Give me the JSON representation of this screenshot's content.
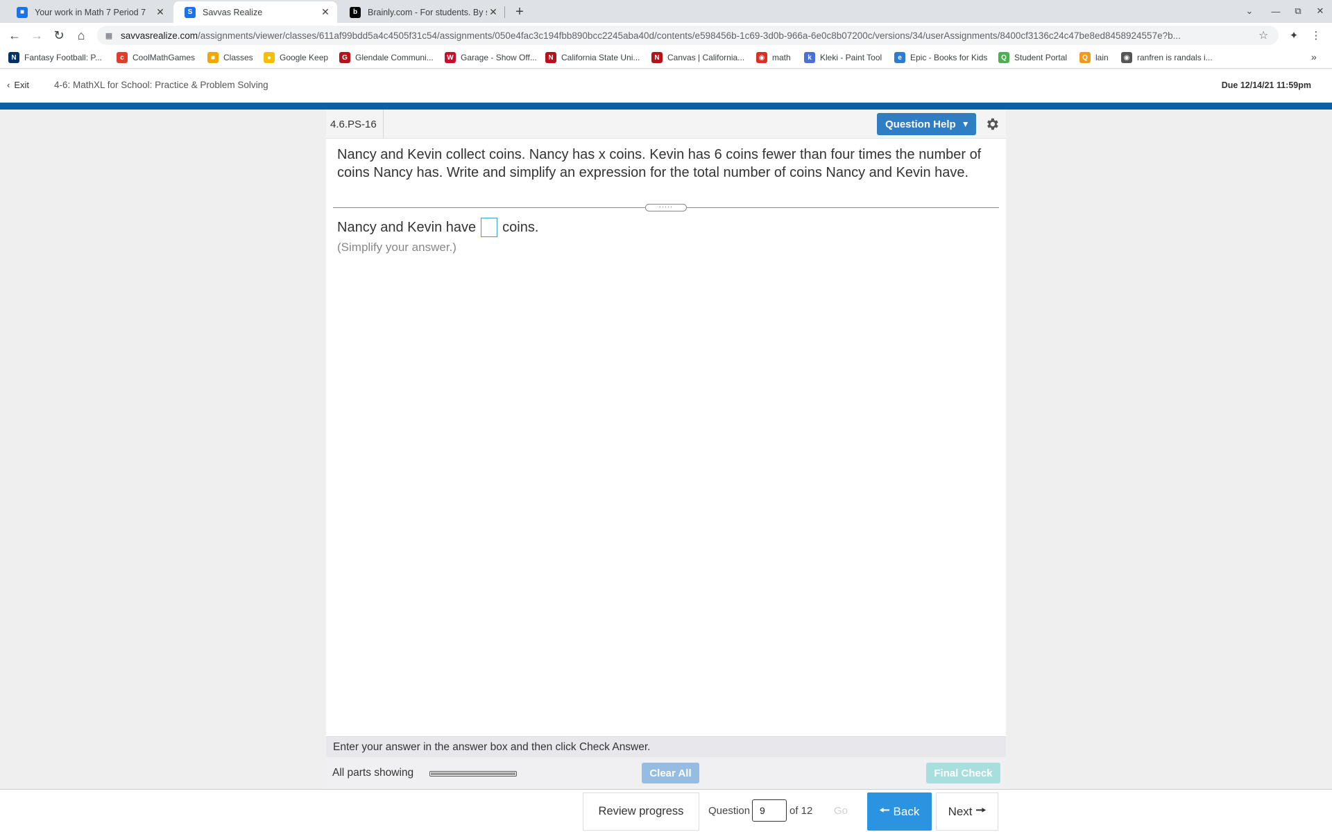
{
  "browser": {
    "tabs": [
      {
        "title": "Your work in Math 7 Period 7",
        "icon": "classroom-icon",
        "color": "#1a73e8"
      },
      {
        "title": "Savvas Realize",
        "icon": "savvas-icon",
        "color": "#1a73e8"
      },
      {
        "title": "Brainly.com - For students. By st",
        "icon": "brainly-icon",
        "color": "#000000"
      }
    ],
    "url_host": "savvasrealize.com",
    "url_path": "/assignments/viewer/classes/611af99bdd5a4c4505f31c54/assignments/050e4fac3c194fbb890bcc2245aba40d/contents/e598456b-1c69-3d0b-966a-6e0c8b07200c/versions/34/userAssignments/8400cf3136c24c47be8ed8458924557e?b...",
    "bookmarks": [
      {
        "label": "Fantasy Football: P...",
        "icon": "nfl-icon",
        "color": "#013369"
      },
      {
        "label": "CoolMathGames",
        "icon": "coolmath-icon",
        "color": "#e23c2b"
      },
      {
        "label": "Classes",
        "icon": "classroom-icon",
        "color": "#f2a600"
      },
      {
        "label": "Google Keep",
        "icon": "keep-icon",
        "color": "#fbbc04"
      },
      {
        "label": "Glendale Communi...",
        "icon": "gusd-icon",
        "color": "#b5121b"
      },
      {
        "label": "Garage - Show Off...",
        "icon": "garage-icon",
        "color": "#c8102e"
      },
      {
        "label": "California State Uni...",
        "icon": "csun-icon",
        "color": "#b5121b"
      },
      {
        "label": "Canvas | California...",
        "icon": "canvas-icon",
        "color": "#b5121b"
      },
      {
        "label": "math",
        "icon": "math-icon",
        "color": "#d93025"
      },
      {
        "label": "Kleki - Paint Tool",
        "icon": "kleki-icon",
        "color": "#4a6fd8"
      },
      {
        "label": "Epic - Books for Kids",
        "icon": "epic-icon",
        "color": "#2e7bcf"
      },
      {
        "label": "Student Portal",
        "icon": "portal-icon",
        "color": "#4caf50"
      },
      {
        "label": "lain",
        "icon": "lain-icon",
        "color": "#f09a1a"
      },
      {
        "label": "ranfren is randals i...",
        "icon": "ranfren-icon",
        "color": "#555555"
      }
    ]
  },
  "app": {
    "exit_label": "Exit",
    "assignment_title": "4-6: MathXL for School: Practice & Problem Solving",
    "due": "Due 12/14/21 11:59pm"
  },
  "question": {
    "id": "4.6.PS-16",
    "help_label": "Question Help",
    "text": "Nancy and Kevin collect coins. Nancy has x coins. Kevin has 6 coins fewer than four times the number of coins Nancy has. Write and simplify an expression for the total number of coins Nancy and Kevin have.",
    "answer_prefix": "Nancy and Kevin have",
    "answer_value": "",
    "answer_suffix": "coins.",
    "hint": "(Simplify your answer.)",
    "instructions": "Enter your answer in the answer box and then click Check Answer.",
    "parts_label": "All parts showing",
    "parts_progress": 1,
    "clear_all": "Clear All",
    "final_check": "Final Check"
  },
  "nav": {
    "review_progress": "Review progress",
    "question_label": "Question",
    "current_question": "9",
    "of_total": "of 12",
    "go": "Go",
    "back": "Back",
    "next": "Next"
  }
}
